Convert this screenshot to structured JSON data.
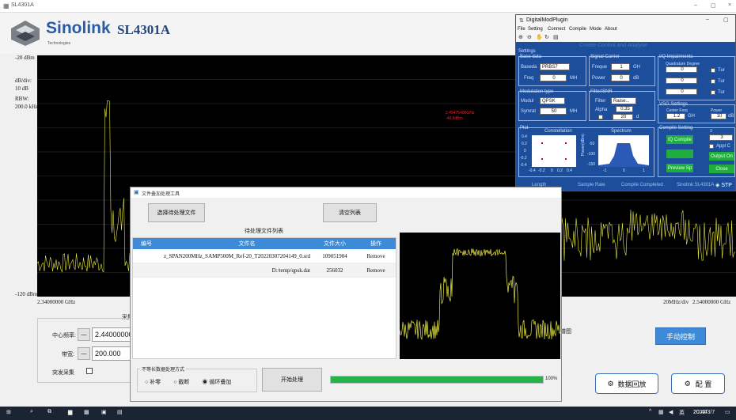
{
  "main_window": {
    "title": "SL4301A",
    "minimize": "–",
    "restore": "▢",
    "close": "×",
    "logo_brand": "Sinolink",
    "logo_sub": "Technologies",
    "model": "SL4301A"
  },
  "plot": {
    "ref_level": "-20 dBm",
    "db_div_label": "dB/div:",
    "db_div": "10 dB",
    "rbw_label": "RBW:",
    "rbw": "200.0 kHz",
    "min_level": "-120 dBm",
    "start_freq": "2.34000000 GHz",
    "span_per_div": "20MHz/div",
    "stop_freq": "2.54000000 GHz",
    "marker_freq": "2.45475400GHz",
    "marker_level": "-46.5dBm"
  },
  "controls": {
    "group_label": "采集",
    "center_freq_label": "中心频率:",
    "center_freq_value": "2.44000000",
    "bandwidth_label": "带宽:",
    "bandwidth_value": "200.000",
    "burst_label": "突发采集",
    "minus": "—",
    "manual_control": "手动控制",
    "playback": "数据回放",
    "config": "配 置",
    "right_label": "谱图"
  },
  "dialog": {
    "title": "文件叠加处理工具",
    "select_button": "选择待处理文件",
    "clear_button": "清空列表",
    "list_title": "待处理文件列表",
    "columns": [
      "编号",
      "文件名",
      "文件大小",
      "操作"
    ],
    "rows": [
      {
        "name": "z_SPAN200MHz_SAMP500M_Ref-20_T20220307204149_0.srd",
        "size": "109051904",
        "op": "Remove"
      },
      {
        "name": "D:/temp/qpsk.dat",
        "size": "256032",
        "op": "Remove"
      }
    ],
    "mode_group": "不等长数据处理方式",
    "options": [
      "补零",
      "截断",
      "循环叠加"
    ],
    "start_button": "开始处理",
    "progress": 100,
    "progress_text": "100%"
  },
  "plugin": {
    "title": "DigitalModPlugin",
    "menu": [
      "File",
      "Setting",
      "Connect",
      "Compile",
      "Mode",
      "About"
    ],
    "banner": "Create Control and Analyse",
    "settings": "Settings",
    "base_data": "Base data",
    "baseda_label": "Baseda",
    "baseda_value": "PRBS7",
    "freq_label": "Freq",
    "freq_value": "0",
    "freq_unit": "MH",
    "signal_carrier": "Signal Carrier",
    "freque_label": "Freque",
    "freque_value": "1",
    "freque_unit": "GH",
    "power_label": "Power",
    "power_value": "0",
    "power_unit": "dB",
    "iq_impairments": "I/Q Impairments",
    "quad_label": "Quadrature Degree",
    "imp_value1": "0",
    "imp_value2": "0",
    "imp_value3": "0",
    "tur": "Tur",
    "mod_type": "Modulation type",
    "modul_label": "Modul",
    "modul_value": "QPSK",
    "symrat_label": "Symrat",
    "symrat_value": "50",
    "symrat_unit": "MH",
    "filter_snr": "Filter/SNR",
    "filter_label": "Filter",
    "filter_value": "Raise...",
    "alpha_label": "Alpha",
    "alpha_value": "0.35",
    "snr_value": "20",
    "snr_unit": "d",
    "vsg_settings": "VSG Settings",
    "center_freq": "Center Freq",
    "vsg_freq": "1.2",
    "vsg_freq_unit": "GH",
    "vsg_power_label": "Power",
    "vsg_power": "10",
    "vsg_power_unit": "dB",
    "plot_group": "Plot",
    "constellation": "Constellation",
    "spectrum": "Spectrum",
    "power_axis": "Power(dBm)",
    "const_y_ticks": [
      "0.4",
      "0.2",
      "0",
      "-0.2",
      "-0.4"
    ],
    "const_x_ticks": [
      "-0.4",
      "-0.2",
      "0",
      "0.2",
      "0.4"
    ],
    "spec_y_ticks": [
      "-50",
      "-100",
      "-150"
    ],
    "spec_x_ticks": [
      "-1",
      "0",
      "1"
    ],
    "compile_setting": "Compile Setting",
    "oversamp": "OverSamp",
    "overs_value": "3",
    "appl_c": "Appl C",
    "iq_compile": "IQ Compile",
    "output_on": "Output On",
    "preview": "Preview Sp",
    "close": "Close",
    "status_length": "Length",
    "status_rate": "Sample Rate",
    "status_done": "Compile Completed",
    "status_brand": "Sinolink SL4301A",
    "status_logo": "STP"
  },
  "taskbar": {
    "time": "20:44",
    "date": "2022/3/7",
    "lang": "英"
  }
}
